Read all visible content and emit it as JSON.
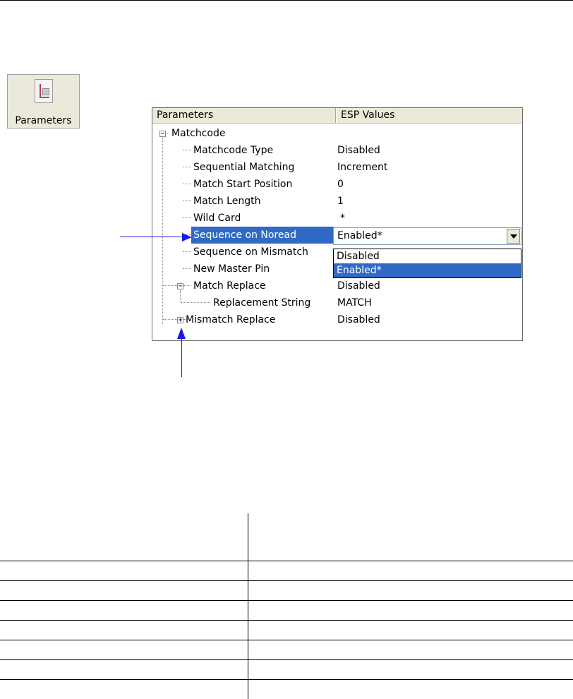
{
  "toolbar": {
    "parameters_button": {
      "label": "Parameters",
      "icon": "parameters-document-icon"
    }
  },
  "grid": {
    "headers": {
      "parameters": "Parameters",
      "esp_values": "ESP Values"
    },
    "rows": [
      {
        "name": "Matchcode",
        "value": "",
        "expander": "−"
      },
      {
        "name": "Matchcode Type",
        "value": "Disabled"
      },
      {
        "name": "Sequential Matching",
        "value": "Increment"
      },
      {
        "name": "Match Start Position",
        "value": "0"
      },
      {
        "name": "Match Length",
        "value": "1"
      },
      {
        "name": "Wild Card",
        "value": "*"
      },
      {
        "name": "Sequence on Noread",
        "value": "Enabled*",
        "selected": true
      },
      {
        "name": "Sequence on Mismatch",
        "value": ""
      },
      {
        "name": "New Master Pin",
        "value": ""
      },
      {
        "name": "Match Replace",
        "value": "Disabled",
        "expander": "−"
      },
      {
        "name": "Replacement String",
        "value": "MATCH"
      },
      {
        "name": "Mismatch Replace",
        "value": "Disabled",
        "expander": "+"
      }
    ]
  },
  "dropdown": {
    "current": "Enabled*",
    "options": [
      "Disabled",
      "Enabled*"
    ],
    "highlighted_index": 1
  },
  "colors": {
    "selection": "#316ac5",
    "arrow": "#1a1ae6",
    "header_bg": "#ece9d8"
  }
}
